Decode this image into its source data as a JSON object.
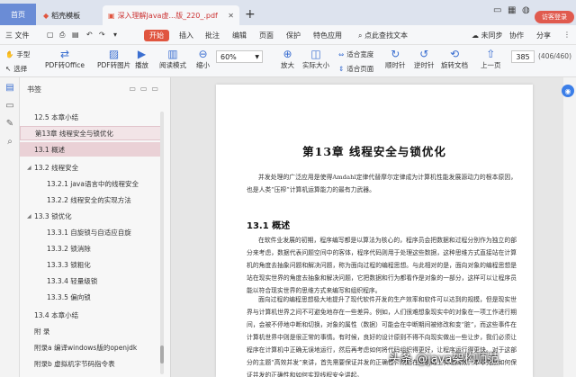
{
  "tabs": {
    "home": "首页",
    "templates": "稻壳模板",
    "document": "深入理解Java虚...版_220_.pdf"
  },
  "top_right": {
    "login": "访客登录"
  },
  "menu": {
    "file": "三 文件",
    "start": "开始",
    "items": [
      "插入",
      "批注",
      "编辑",
      "页面",
      "保护",
      "特色应用"
    ],
    "search": "点此查找文本",
    "sync": "未同步",
    "collab": "协作",
    "share": "分享"
  },
  "toolbar": {
    "hand": "手型",
    "select": "选择",
    "pdf_office": "PDF转Office",
    "pdf_image": "PDF转图片",
    "play": "播放",
    "read_mode": "阅读模式",
    "zoom_out": "缩小",
    "zoom_value": "60%",
    "zoom_in": "放大",
    "actual_size": "实际大小",
    "fit_width": "适合宽度",
    "fit_page": "适合页面",
    "rotate_cw": "顺时针",
    "rotate_ccw": "逆时针",
    "rotate_doc": "旋转文档",
    "prev_page": "上一页",
    "page_number": "385",
    "page_count": "(406/460)"
  },
  "bookmarks": {
    "title": "书签",
    "items": [
      {
        "label": "12.5  本章小结"
      },
      {
        "label": "第13章  线程安全与锁优化"
      },
      {
        "label": "13.1  概述"
      },
      {
        "label": "13.2  线程安全"
      },
      {
        "label": "13.2.1  java语言中的线程安全"
      },
      {
        "label": "13.2.2  线程安全的实现方法"
      },
      {
        "label": "13.3  锁优化"
      },
      {
        "label": "13.3.1  自旋锁与自适应自旋"
      },
      {
        "label": "13.3.2  锁消除"
      },
      {
        "label": "13.3.3  锁粗化"
      },
      {
        "label": "13.3.4  轻量级锁"
      },
      {
        "label": "13.3.5  偏向锁"
      },
      {
        "label": "13.4  本章小结"
      },
      {
        "label": "附  录"
      },
      {
        "label": "附录a  编译windows版的openjdk"
      },
      {
        "label": "附录b  虚拟机字节码指令表"
      }
    ]
  },
  "page": {
    "chapter": "第13章   线程安全与锁优化",
    "intro": "并发处理的广泛应用是使得Amdahl定律代替摩尔定律成为计算机性能发展源动力的根本原因，也是人类“压榨”计算机运算能力的最有力武器。",
    "section": "13.1   概述",
    "p1": "在软件业发展的初期，程序编写都是以算法为核心的，程序员会把数据和过程分别作为独立的部分来考虑，数据代表问题空间中的客体，程序代码则用于处理这些数据，这种思维方式直接站在计算机的角度去抽象问题和解决问题，称为面向过程的编程思想。与此相对的是，面向对象的编程思想是站在现实世界的角度去抽象和解决问题，它把数据和行为都看作是对象的一部分，这样可以让程序员能以符合现实世界的思维方式来编写和组织程序。",
    "p2": "面向过程的编程思想极大地提升了现代软件开发的生产效率和软件可以达到的规模，但是现实世界与计算机世界之间不可避免地存在一些差异。例如，人们很难想象现实中的对象在一项工作进行期间，会被不停地中断和切换，对象的属性（数据）可能会在中断期间被修改和变“脏”，而这些事件在计算机世界中则是很正常的事情。有时候，良好的设计原则不得不向现实做出一些让步，我们必须让程序在计算机中正确无误地运行，然后再考虑如何将代码组织得更好，让程序运行得更快。对于这部分的主题“高效并发”来讲，首先需要保证并发的正确性，然后在此基础上实现高效。本章先从如何保证并发的正确性和如何实现线程安全讲起。"
  },
  "watermark": "头条 @java架构师范"
}
